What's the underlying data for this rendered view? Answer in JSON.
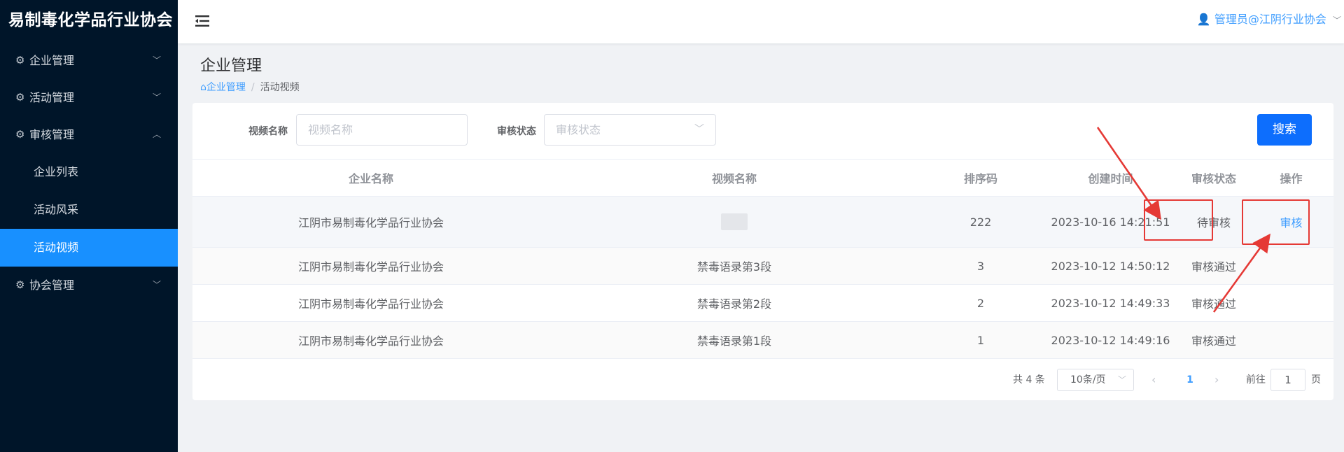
{
  "sidebar": {
    "logo": "易制毒化学品行业协会",
    "menus": [
      {
        "label": "企业管理",
        "chevron": "﹀"
      },
      {
        "label": "活动管理",
        "chevron": "﹀"
      },
      {
        "label": "审核管理",
        "chevron": "︿"
      },
      {
        "label": "协会管理",
        "chevron": "﹀"
      }
    ],
    "sub_items": [
      {
        "label": "企业列表"
      },
      {
        "label": "活动风采"
      },
      {
        "label": "活动视频"
      }
    ]
  },
  "header": {
    "user": "管理员@江阴行业协会",
    "user_icon": "user-icon",
    "fold_icon": "menu-fold-icon"
  },
  "page": {
    "title": "企业管理",
    "breadcrumb": {
      "home": "企业管理",
      "separator": "/",
      "current": "活动视频"
    }
  },
  "filters": {
    "video_name_label": "视频名称",
    "video_name_placeholder": "视频名称",
    "status_label": "审核状态",
    "status_placeholder": "审核状态",
    "search_button": "搜索"
  },
  "table": {
    "columns": [
      "企业名称",
      "视频名称",
      "排序码",
      "创建时间",
      "审核状态",
      "操作"
    ],
    "rows": [
      {
        "company": "江阴市易制毒化学品行业协会",
        "video": "",
        "sort": "222",
        "created": "2023-10-16 14:21:51",
        "status": "待审核",
        "action": "审核"
      },
      {
        "company": "江阴市易制毒化学品行业协会",
        "video": "禁毒语录第3段",
        "sort": "3",
        "created": "2023-10-12 14:50:12",
        "status": "审核通过",
        "action": ""
      },
      {
        "company": "江阴市易制毒化学品行业协会",
        "video": "禁毒语录第2段",
        "sort": "2",
        "created": "2023-10-12 14:49:33",
        "status": "审核通过",
        "action": ""
      },
      {
        "company": "江阴市易制毒化学品行业协会",
        "video": "禁毒语录第1段",
        "sort": "1",
        "created": "2023-10-12 14:49:16",
        "status": "审核通过",
        "action": ""
      }
    ]
  },
  "pagination": {
    "total": "共 4 条",
    "page_size": "10条/页",
    "prev": "‹",
    "current_page": "1",
    "next": "›",
    "goto_label": "前往",
    "goto_value": "1",
    "page_suffix": "页"
  },
  "colors": {
    "sidebar_bg": "#001529",
    "active": "#1890ff",
    "primary": "#0d6efd",
    "annotation": "#e53935"
  }
}
